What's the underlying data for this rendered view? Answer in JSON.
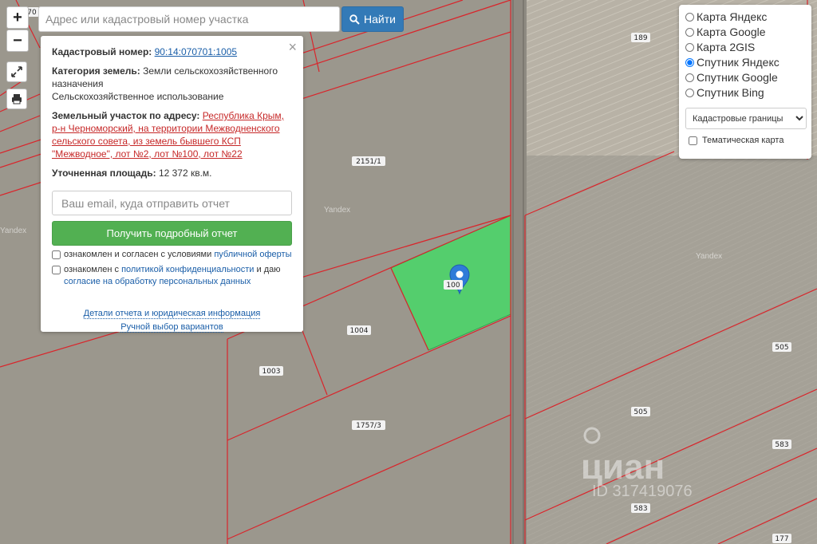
{
  "search": {
    "placeholder": "Адрес или кадастровый номер участка",
    "button_label": "Найти"
  },
  "map_controls": {
    "zoom_in": "+",
    "zoom_out": "−"
  },
  "info_panel": {
    "cadastral_label": "Кадастровый номер:",
    "cadastral_value": "90:14:070701:1005",
    "category_label": "Категория земель:",
    "category_value": "Земли сельскохозяйственного назначения",
    "use_value": "Сельскохозяйственное использование",
    "address_label": "Земельный участок по адресу:",
    "address_value": "Республика Крым, р-н Черноморский, на территории Межводненского сельского совета, из земель бывшего КСП \"Межводное\", лот №2, лот №100, лот №22",
    "area_label": "Уточненная площадь:",
    "area_value": "12 372 кв.м.",
    "email_placeholder": "Ваш email, куда отправить отчет",
    "report_button": "Получить подробный отчет",
    "consent1_text": "ознакомлен и согласен с условиями ",
    "consent1_link": "публичной оферты",
    "consent2_text": "ознакомлен с ",
    "consent2_link": "политикой конфиденциальности",
    "consent2_text2": " и даю ",
    "consent2_link2": "согласие на обработку персональных данных",
    "details_link": "Детали отчета и юридическая информация",
    "manual_link": "Ручной выбор вариантов"
  },
  "layers": {
    "options": [
      "Карта Яндекс",
      "Карта Google",
      "Карта 2GIS",
      "Спутник Яндекс",
      "Спутник Google",
      "Спутник Bing"
    ],
    "selected": "Спутник Яндекс",
    "boundary_select": "Кадастровые границы",
    "thematic_label": "Тематическая карта"
  },
  "map": {
    "parcel_labels": [
      "189",
      "2151/1",
      "1004",
      "1003",
      "1757/3",
      "505",
      "505",
      "583",
      "583",
      "177",
      "70",
      "100"
    ],
    "watermarks": [
      "Yandex",
      "Yandex",
      "Yandex"
    ],
    "cian_watermark": "циан",
    "cian_id": "ID 317419076",
    "colors": {
      "boundary": "#d9252b",
      "selected_parcel": "#4ed36a",
      "marker": "#2f7bd8"
    }
  }
}
